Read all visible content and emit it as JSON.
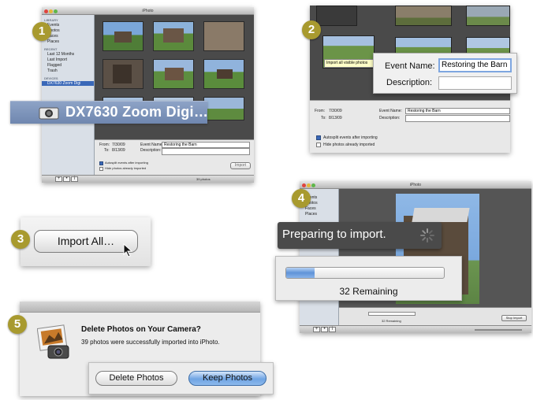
{
  "steps": {
    "s1": "1",
    "s2": "2",
    "s3": "3",
    "s4": "4",
    "s5": "5"
  },
  "app_title": "iPhoto",
  "sidebar": {
    "library_header": "LIBRARY",
    "library_items": [
      "Events",
      "Photos",
      "Faces",
      "Places"
    ],
    "recent_header": "RECENT",
    "recent_items": [
      "Last 12 Months",
      "Last Import",
      "Flagged",
      "Trash"
    ],
    "devices_header": "DEVICES",
    "device_item": "DX7630 Zoom Digi"
  },
  "device_label_zoom": "DX7630 Zoom Digi…",
  "import_form": {
    "from_label": "From:",
    "from_value": "7/30/09",
    "to_label": "To:",
    "to_value": "8/13/09",
    "event_name_label": "Event Name:",
    "event_name_value": "Restoring the Barn",
    "description_label": "Description:",
    "autosplit_label": "Autosplit events after importing",
    "hide_label": "Hide photos already imported",
    "import_button": "Import"
  },
  "panel1_status": "39 photos",
  "panel2_tooltip": "Import all visible photos",
  "import_all_button": "Import All…",
  "progress": {
    "preparing_text": "Preparing to import.",
    "remaining_text": "32 Remaining",
    "progress_fraction": 0.18,
    "mini_remaining": "32 Remaining",
    "stop_button": "Stop Import"
  },
  "dialog": {
    "title": "Delete Photos on Your Camera?",
    "message": "39 photos were successfully imported into iPhoto.",
    "delete_button": "Delete Photos",
    "keep_button": "Keep Photos"
  },
  "icons": [
    "camera-icon",
    "spinner-icon",
    "pointer-cursor-icon",
    "iphoto-app-icon"
  ],
  "colors": {
    "badge": "#a89a2f",
    "selection": "#3a68b8",
    "keep_button": "#6fa4e3"
  }
}
